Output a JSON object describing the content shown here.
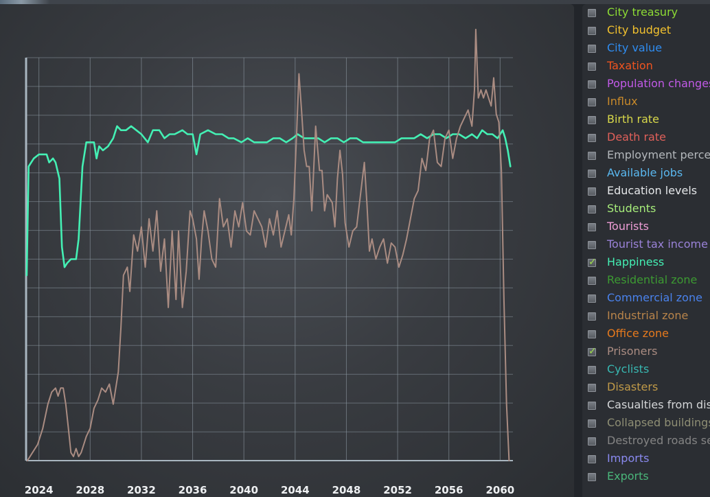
{
  "legend": [
    {
      "label": "City treasury",
      "color": "#8ddc34",
      "checked": false,
      "icon": "checkbox-icon"
    },
    {
      "label": "City budget",
      "color": "#f2c12e",
      "checked": false,
      "icon": "checkbox-icon"
    },
    {
      "label": "City value",
      "color": "#2f8cf0",
      "checked": false,
      "icon": "checkbox-icon"
    },
    {
      "label": "Taxation",
      "color": "#f0541f",
      "checked": false,
      "icon": "checkbox-icon"
    },
    {
      "label": "Population changes",
      "color": "#c25ae8",
      "checked": false,
      "icon": "checkbox-icon"
    },
    {
      "label": "Influx",
      "color": "#c98a2a",
      "checked": false,
      "icon": "checkbox-icon"
    },
    {
      "label": "Birth rate",
      "color": "#d8d84a",
      "checked": false,
      "icon": "checkbox-icon"
    },
    {
      "label": "Death rate",
      "color": "#e0605a",
      "checked": false,
      "icon": "checkbox-icon"
    },
    {
      "label": "Employment perce",
      "color": "#b4b8bc",
      "checked": false,
      "icon": "checkbox-icon"
    },
    {
      "label": "Available jobs",
      "color": "#5ab8f0",
      "checked": false,
      "icon": "checkbox-icon"
    },
    {
      "label": "Education levels",
      "color": "#e6e8ea",
      "checked": false,
      "icon": "checkbox-icon"
    },
    {
      "label": "Students",
      "color": "#a6ec7a",
      "checked": false,
      "icon": "checkbox-icon"
    },
    {
      "label": "Tourists",
      "color": "#ee9ed6",
      "checked": false,
      "icon": "checkbox-icon"
    },
    {
      "label": "Tourist tax income",
      "color": "#9a82d8",
      "checked": false,
      "icon": "checkbox-icon"
    },
    {
      "label": "Happiness",
      "color": "#44f0b4",
      "checked": true,
      "icon": "checkbox-icon"
    },
    {
      "label": "Residential zone",
      "color": "#3c9a32",
      "checked": false,
      "icon": "checkbox-icon"
    },
    {
      "label": "Commercial zone",
      "color": "#4a82ec",
      "checked": false,
      "icon": "checkbox-icon"
    },
    {
      "label": "Industrial zone",
      "color": "#b8844a",
      "checked": false,
      "icon": "checkbox-icon"
    },
    {
      "label": "Office zone",
      "color": "#e67a1e",
      "checked": false,
      "icon": "checkbox-icon"
    },
    {
      "label": "Prisoners",
      "color": "#aa8c82",
      "checked": true,
      "icon": "checkbox-icon"
    },
    {
      "label": "Cyclists",
      "color": "#38b8b2",
      "checked": false,
      "icon": "checkbox-icon"
    },
    {
      "label": "Disasters",
      "color": "#c09a48",
      "checked": false,
      "icon": "checkbox-icon"
    },
    {
      "label": "Casualties from dis",
      "color": "#d4d6d8",
      "checked": false,
      "icon": "checkbox-icon"
    },
    {
      "label": "Collapsed buildings",
      "color": "#8e8e74",
      "checked": false,
      "icon": "checkbox-icon"
    },
    {
      "label": "Destroyed roads se",
      "color": "#848484",
      "checked": false,
      "icon": "checkbox-icon"
    },
    {
      "label": "Imports",
      "color": "#8a8af0",
      "checked": false,
      "icon": "checkbox-icon"
    },
    {
      "label": "Exports",
      "color": "#4ab67a",
      "checked": false,
      "icon": "checkbox-icon"
    }
  ],
  "chart_data": {
    "type": "line",
    "x_tick_labels": [
      "2024",
      "2028",
      "2032",
      "2036",
      "2040",
      "2044",
      "2048",
      "2052",
      "2056",
      "2060"
    ],
    "x_range": [
      2023,
      2061
    ],
    "y_range": [
      0,
      100
    ],
    "grid": true,
    "series": [
      {
        "name": "Happiness",
        "color": "#44f0b4",
        "points": [
          [
            2023.05,
            46
          ],
          [
            2023.2,
            73
          ],
          [
            2023.6,
            75
          ],
          [
            2024.0,
            76
          ],
          [
            2024.6,
            76
          ],
          [
            2024.8,
            74
          ],
          [
            2025.1,
            75
          ],
          [
            2025.3,
            74
          ],
          [
            2025.6,
            70
          ],
          [
            2025.8,
            53
          ],
          [
            2026.0,
            48
          ],
          [
            2026.2,
            49
          ],
          [
            2026.5,
            50
          ],
          [
            2026.9,
            50
          ],
          [
            2027.1,
            55
          ],
          [
            2027.4,
            73
          ],
          [
            2027.7,
            79
          ],
          [
            2028.0,
            79
          ],
          [
            2028.3,
            79
          ],
          [
            2028.5,
            75
          ],
          [
            2028.7,
            78
          ],
          [
            2029.0,
            77
          ],
          [
            2029.4,
            78
          ],
          [
            2029.8,
            80
          ],
          [
            2030.1,
            83
          ],
          [
            2030.4,
            82
          ],
          [
            2030.8,
            82
          ],
          [
            2031.2,
            83
          ],
          [
            2031.6,
            82
          ],
          [
            2032.0,
            81
          ],
          [
            2032.5,
            79
          ],
          [
            2032.9,
            82
          ],
          [
            2033.4,
            82
          ],
          [
            2033.8,
            80
          ],
          [
            2034.2,
            81
          ],
          [
            2034.6,
            81
          ],
          [
            2035.2,
            82
          ],
          [
            2035.6,
            81
          ],
          [
            2036.0,
            81
          ],
          [
            2036.3,
            76
          ],
          [
            2036.6,
            81
          ],
          [
            2037.2,
            82
          ],
          [
            2037.8,
            81
          ],
          [
            2038.3,
            81
          ],
          [
            2038.8,
            80
          ],
          [
            2039.2,
            80
          ],
          [
            2039.8,
            79
          ],
          [
            2040.3,
            80
          ],
          [
            2040.8,
            79
          ],
          [
            2041.3,
            79
          ],
          [
            2041.8,
            79
          ],
          [
            2042.3,
            80
          ],
          [
            2042.8,
            80
          ],
          [
            2043.3,
            79
          ],
          [
            2043.8,
            80
          ],
          [
            2044.2,
            81
          ],
          [
            2044.7,
            80
          ],
          [
            2045.3,
            80
          ],
          [
            2045.8,
            80
          ],
          [
            2046.3,
            79
          ],
          [
            2046.8,
            80
          ],
          [
            2047.3,
            80
          ],
          [
            2047.8,
            79
          ],
          [
            2048.3,
            80
          ],
          [
            2048.8,
            80
          ],
          [
            2049.3,
            79
          ],
          [
            2049.8,
            79
          ],
          [
            2050.3,
            79
          ],
          [
            2050.8,
            79
          ],
          [
            2051.3,
            79
          ],
          [
            2051.8,
            79
          ],
          [
            2052.3,
            80
          ],
          [
            2052.8,
            80
          ],
          [
            2053.3,
            80
          ],
          [
            2053.8,
            81
          ],
          [
            2054.3,
            80
          ],
          [
            2054.8,
            81
          ],
          [
            2055.3,
            81
          ],
          [
            2055.8,
            80
          ],
          [
            2056.3,
            81
          ],
          [
            2056.8,
            81
          ],
          [
            2057.3,
            80
          ],
          [
            2057.8,
            81
          ],
          [
            2058.2,
            80
          ],
          [
            2058.6,
            82
          ],
          [
            2059.0,
            81
          ],
          [
            2059.4,
            81
          ],
          [
            2059.8,
            80
          ],
          [
            2060.2,
            82
          ],
          [
            2060.4,
            80
          ],
          [
            2060.6,
            77
          ],
          [
            2060.8,
            73
          ]
        ]
      },
      {
        "name": "Prisoners",
        "color": "#aa8c82",
        "points": [
          [
            2023.1,
            0
          ],
          [
            2023.5,
            2
          ],
          [
            2023.9,
            4
          ],
          [
            2024.3,
            8
          ],
          [
            2024.7,
            14
          ],
          [
            2025.0,
            17
          ],
          [
            2025.3,
            18
          ],
          [
            2025.5,
            16
          ],
          [
            2025.7,
            18
          ],
          [
            2025.9,
            18
          ],
          [
            2026.1,
            14
          ],
          [
            2026.3,
            8
          ],
          [
            2026.5,
            2
          ],
          [
            2026.7,
            1
          ],
          [
            2026.9,
            3
          ],
          [
            2027.1,
            1
          ],
          [
            2027.3,
            2
          ],
          [
            2027.5,
            4
          ],
          [
            2027.7,
            6
          ],
          [
            2028.0,
            8
          ],
          [
            2028.3,
            13
          ],
          [
            2028.6,
            15
          ],
          [
            2028.9,
            18
          ],
          [
            2029.2,
            17
          ],
          [
            2029.5,
            19
          ],
          [
            2029.8,
            14
          ],
          [
            2030.0,
            18
          ],
          [
            2030.2,
            22
          ],
          [
            2030.4,
            33
          ],
          [
            2030.6,
            46
          ],
          [
            2030.9,
            48
          ],
          [
            2031.1,
            42
          ],
          [
            2031.4,
            56
          ],
          [
            2031.7,
            52
          ],
          [
            2032.0,
            58
          ],
          [
            2032.3,
            48
          ],
          [
            2032.6,
            60
          ],
          [
            2032.9,
            52
          ],
          [
            2033.2,
            62
          ],
          [
            2033.5,
            47
          ],
          [
            2033.8,
            55
          ],
          [
            2034.1,
            38
          ],
          [
            2034.4,
            57
          ],
          [
            2034.7,
            40
          ],
          [
            2034.9,
            57
          ],
          [
            2035.2,
            38
          ],
          [
            2035.5,
            47
          ],
          [
            2035.8,
            62
          ],
          [
            2036.0,
            60
          ],
          [
            2036.3,
            55
          ],
          [
            2036.5,
            45
          ],
          [
            2036.7,
            55
          ],
          [
            2036.9,
            62
          ],
          [
            2037.2,
            57
          ],
          [
            2037.5,
            50
          ],
          [
            2037.8,
            48
          ],
          [
            2038.1,
            65
          ],
          [
            2038.4,
            58
          ],
          [
            2038.7,
            60
          ],
          [
            2039.0,
            53
          ],
          [
            2039.3,
            62
          ],
          [
            2039.6,
            58
          ],
          [
            2039.9,
            64
          ],
          [
            2040.2,
            57
          ],
          [
            2040.5,
            56
          ],
          [
            2040.8,
            62
          ],
          [
            2041.1,
            60
          ],
          [
            2041.4,
            58
          ],
          [
            2041.7,
            53
          ],
          [
            2042.0,
            60
          ],
          [
            2042.3,
            56
          ],
          [
            2042.6,
            62
          ],
          [
            2042.9,
            53
          ],
          [
            2043.2,
            57
          ],
          [
            2043.5,
            61
          ],
          [
            2043.7,
            56
          ],
          [
            2043.9,
            65
          ],
          [
            2044.1,
            80
          ],
          [
            2044.3,
            96
          ],
          [
            2044.5,
            87
          ],
          [
            2044.7,
            77
          ],
          [
            2044.9,
            73
          ],
          [
            2045.1,
            73
          ],
          [
            2045.3,
            62
          ],
          [
            2045.6,
            83
          ],
          [
            2045.9,
            72
          ],
          [
            2046.1,
            72
          ],
          [
            2046.3,
            62
          ],
          [
            2046.5,
            66
          ],
          [
            2046.7,
            65
          ],
          [
            2046.9,
            64
          ],
          [
            2047.1,
            58
          ],
          [
            2047.3,
            70
          ],
          [
            2047.5,
            77
          ],
          [
            2047.7,
            71
          ],
          [
            2047.9,
            59
          ],
          [
            2048.2,
            53
          ],
          [
            2048.5,
            57
          ],
          [
            2048.8,
            58
          ],
          [
            2049.1,
            66
          ],
          [
            2049.4,
            74
          ],
          [
            2049.6,
            64
          ],
          [
            2049.8,
            52
          ],
          [
            2050.0,
            55
          ],
          [
            2050.3,
            50
          ],
          [
            2050.6,
            53
          ],
          [
            2050.9,
            55
          ],
          [
            2051.2,
            49
          ],
          [
            2051.5,
            54
          ],
          [
            2051.8,
            53
          ],
          [
            2052.1,
            48
          ],
          [
            2052.4,
            51
          ],
          [
            2052.7,
            55
          ],
          [
            2053.0,
            60
          ],
          [
            2053.3,
            65
          ],
          [
            2053.6,
            67
          ],
          [
            2053.9,
            75
          ],
          [
            2054.2,
            72
          ],
          [
            2054.5,
            80
          ],
          [
            2054.8,
            82
          ],
          [
            2055.1,
            74
          ],
          [
            2055.4,
            73
          ],
          [
            2055.7,
            80
          ],
          [
            2056.0,
            82
          ],
          [
            2056.3,
            75
          ],
          [
            2056.6,
            80
          ],
          [
            2056.9,
            83
          ],
          [
            2057.2,
            85
          ],
          [
            2057.5,
            87
          ],
          [
            2057.8,
            83
          ],
          [
            2058.0,
            92
          ],
          [
            2058.1,
            107
          ],
          [
            2058.3,
            90
          ],
          [
            2058.5,
            92
          ],
          [
            2058.7,
            90
          ],
          [
            2058.9,
            92
          ],
          [
            2059.1,
            90
          ],
          [
            2059.3,
            88
          ],
          [
            2059.5,
            95
          ],
          [
            2059.7,
            86
          ],
          [
            2059.9,
            84
          ],
          [
            2060.1,
            72
          ],
          [
            2060.3,
            40
          ],
          [
            2060.5,
            14
          ],
          [
            2060.7,
            0
          ]
        ]
      }
    ]
  }
}
